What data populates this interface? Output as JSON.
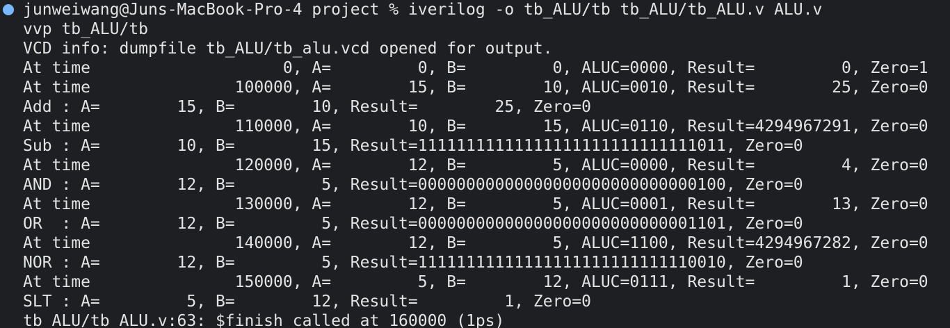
{
  "terminal": {
    "colors": {
      "background": "#1e1f22",
      "text": "#e3e3e3",
      "prompt_dot": "#79b8ff"
    },
    "prompt_icon": "prompt-status-dot",
    "lines": [
      "junweiwang@Juns-MacBook-Pro-4 project % iverilog -o tb_ALU/tb tb_ALU/tb_ALU.v ALU.v",
      "vvp tb_ALU/tb",
      "VCD info: dumpfile tb_ALU/tb_alu.vcd opened for output.",
      "At time                    0, A=         0, B=         0, ALUC=0000, Result=         0, Zero=1",
      "At time               100000, A=        15, B=        10, ALUC=0010, Result=        25, Zero=0",
      "Add : A=        15, B=        10, Result=        25, Zero=0",
      "At time               110000, A=        10, B=        15, ALUC=0110, Result=4294967291, Zero=0",
      "Sub : A=        10, B=        15, Result=11111111111111111111111111111011, Zero=0",
      "At time               120000, A=        12, B=         5, ALUC=0000, Result=         4, Zero=0",
      "AND : A=        12, B=         5, Result=00000000000000000000000000000100, Zero=0",
      "At time               130000, A=        12, B=         5, ALUC=0001, Result=        13, Zero=0",
      "OR  : A=        12, B=         5, Result=00000000000000000000000000001101, Zero=0",
      "At time               140000, A=        12, B=         5, ALUC=1100, Result=4294967282, Zero=0",
      "NOR : A=        12, B=         5, Result=11111111111111111111111111110010, Zero=0",
      "At time               150000, A=         5, B=        12, ALUC=0111, Result=         1, Zero=0",
      "SLT : A=         5, B=        12, Result=         1, Zero=0",
      "tb_ALU/tb_ALU.v:63: $finish called at 160000 (1ps)"
    ]
  }
}
